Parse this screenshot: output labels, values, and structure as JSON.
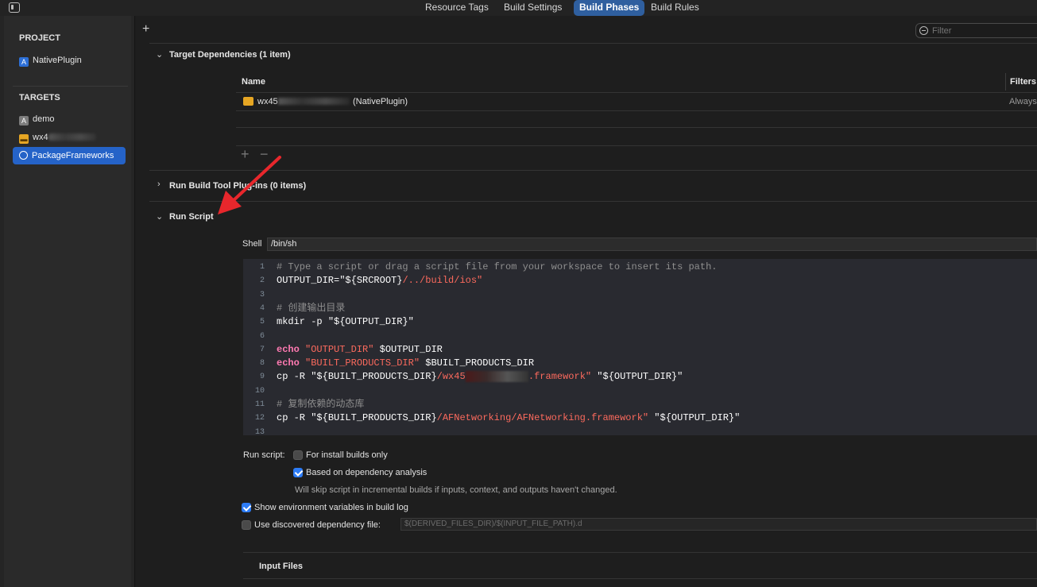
{
  "tabs": [
    {
      "label": "Resource Tags",
      "active": false
    },
    {
      "label": "Build Settings",
      "active": false
    },
    {
      "label": "Build Phases",
      "active": true
    },
    {
      "label": "Build Rules",
      "active": false
    }
  ],
  "sidebar": {
    "project_heading": "PROJECT",
    "project_item": "NativePlugin",
    "targets_heading": "TARGETS",
    "targets": [
      {
        "label": "demo",
        "icon": "app-target-icon"
      },
      {
        "label": "wx4",
        "icon": "framework-toolbox-icon",
        "redacted": true
      },
      {
        "label": "PackageFrameworks",
        "icon": "aggregate-target-icon",
        "selected": true
      }
    ]
  },
  "toolbar": {
    "add_symbol": "+",
    "filter_placeholder": "Filter"
  },
  "target_dependencies": {
    "title": "Target Dependencies (1 item)",
    "columns": [
      "Name",
      "Filters"
    ],
    "rows": [
      {
        "name_visible_prefix": "wx45",
        "name_suffix": "(NativePlugin)",
        "filter": "Always"
      }
    ],
    "add_symbol": "+",
    "remove_symbol": "−"
  },
  "run_build_tool_plugins": {
    "title": "Run Build Tool Plug-ins (0 items)"
  },
  "run_script": {
    "title": "Run Script",
    "shell_label": "Shell",
    "shell_value": "/bin/sh",
    "code_lines": [
      {
        "n": "1",
        "parts": [
          {
            "t": "# Type a script or drag a script file from your workspace to insert its path.",
            "c": "comment"
          }
        ]
      },
      {
        "n": "2",
        "parts": [
          {
            "t": "OUTPUT_DIR=",
            "c": "plain"
          },
          {
            "t": "\"${SRCROOT}",
            "c": "plain"
          },
          {
            "t": "/../build/ios\"",
            "c": "str"
          }
        ]
      },
      {
        "n": "3",
        "parts": []
      },
      {
        "n": "4",
        "parts": [
          {
            "t": "# 创建输出目录",
            "c": "comment"
          }
        ]
      },
      {
        "n": "5",
        "parts": [
          {
            "t": "mkdir -p ",
            "c": "plain"
          },
          {
            "t": "\"${OUTPUT_DIR}\"",
            "c": "plain"
          }
        ]
      },
      {
        "n": "6",
        "parts": []
      },
      {
        "n": "7",
        "parts": [
          {
            "t": "echo ",
            "c": "kw"
          },
          {
            "t": "\"OUTPUT_DIR\"",
            "c": "str"
          },
          {
            "t": " $OUTPUT_DIR",
            "c": "plain"
          }
        ]
      },
      {
        "n": "8",
        "parts": [
          {
            "t": "echo ",
            "c": "kw"
          },
          {
            "t": "\"BUILT_PRODUCTS_DIR\"",
            "c": "str"
          },
          {
            "t": " $BUILT_PRODUCTS_DIR",
            "c": "plain"
          }
        ]
      },
      {
        "n": "9",
        "parts": [
          {
            "t": "cp -R ",
            "c": "plain"
          },
          {
            "t": "\"${BUILT_PRODUCTS_DIR}",
            "c": "plain"
          },
          {
            "t": "/wx45",
            "c": "str"
          },
          {
            "t": "███████████",
            "c": "redact"
          },
          {
            "t": ".framework\"",
            "c": "str"
          },
          {
            "t": " \"${OUTPUT_DIR}\"",
            "c": "plain"
          }
        ]
      },
      {
        "n": "10",
        "parts": []
      },
      {
        "n": "11",
        "parts": [
          {
            "t": "# 复制依赖的动态库",
            "c": "comment"
          }
        ]
      },
      {
        "n": "12",
        "parts": [
          {
            "t": "cp -R ",
            "c": "plain"
          },
          {
            "t": "\"${BUILT_PRODUCTS_DIR}",
            "c": "plain"
          },
          {
            "t": "/AFNetworking/AFNetworking.framework\"",
            "c": "str"
          },
          {
            "t": " \"${OUTPUT_DIR}\"",
            "c": "plain"
          }
        ]
      },
      {
        "n": "13",
        "parts": []
      }
    ],
    "run_script_label": "Run script:",
    "install_builds_only": {
      "label": "For install builds only",
      "checked": false
    },
    "dependency_analysis": {
      "label": "Based on dependency analysis",
      "checked": true
    },
    "dependency_hint": "Will skip script in incremental builds if inputs, context, and outputs haven't changed.",
    "show_env_vars": {
      "label": "Show environment variables in build log",
      "checked": true
    },
    "discovered_dep_file": {
      "label": "Use discovered dependency file:",
      "checked": false,
      "placeholder": "$(DERIVED_FILES_DIR)/$(INPUT_FILE_PATH).d"
    },
    "input_files_title": "Input Files"
  },
  "colors": {
    "accent_selected": "#2563c8",
    "active_tab": "#2f5f9f",
    "annotation_arrow": "#e8272c",
    "checkbox_on": "#2d7cf6"
  }
}
